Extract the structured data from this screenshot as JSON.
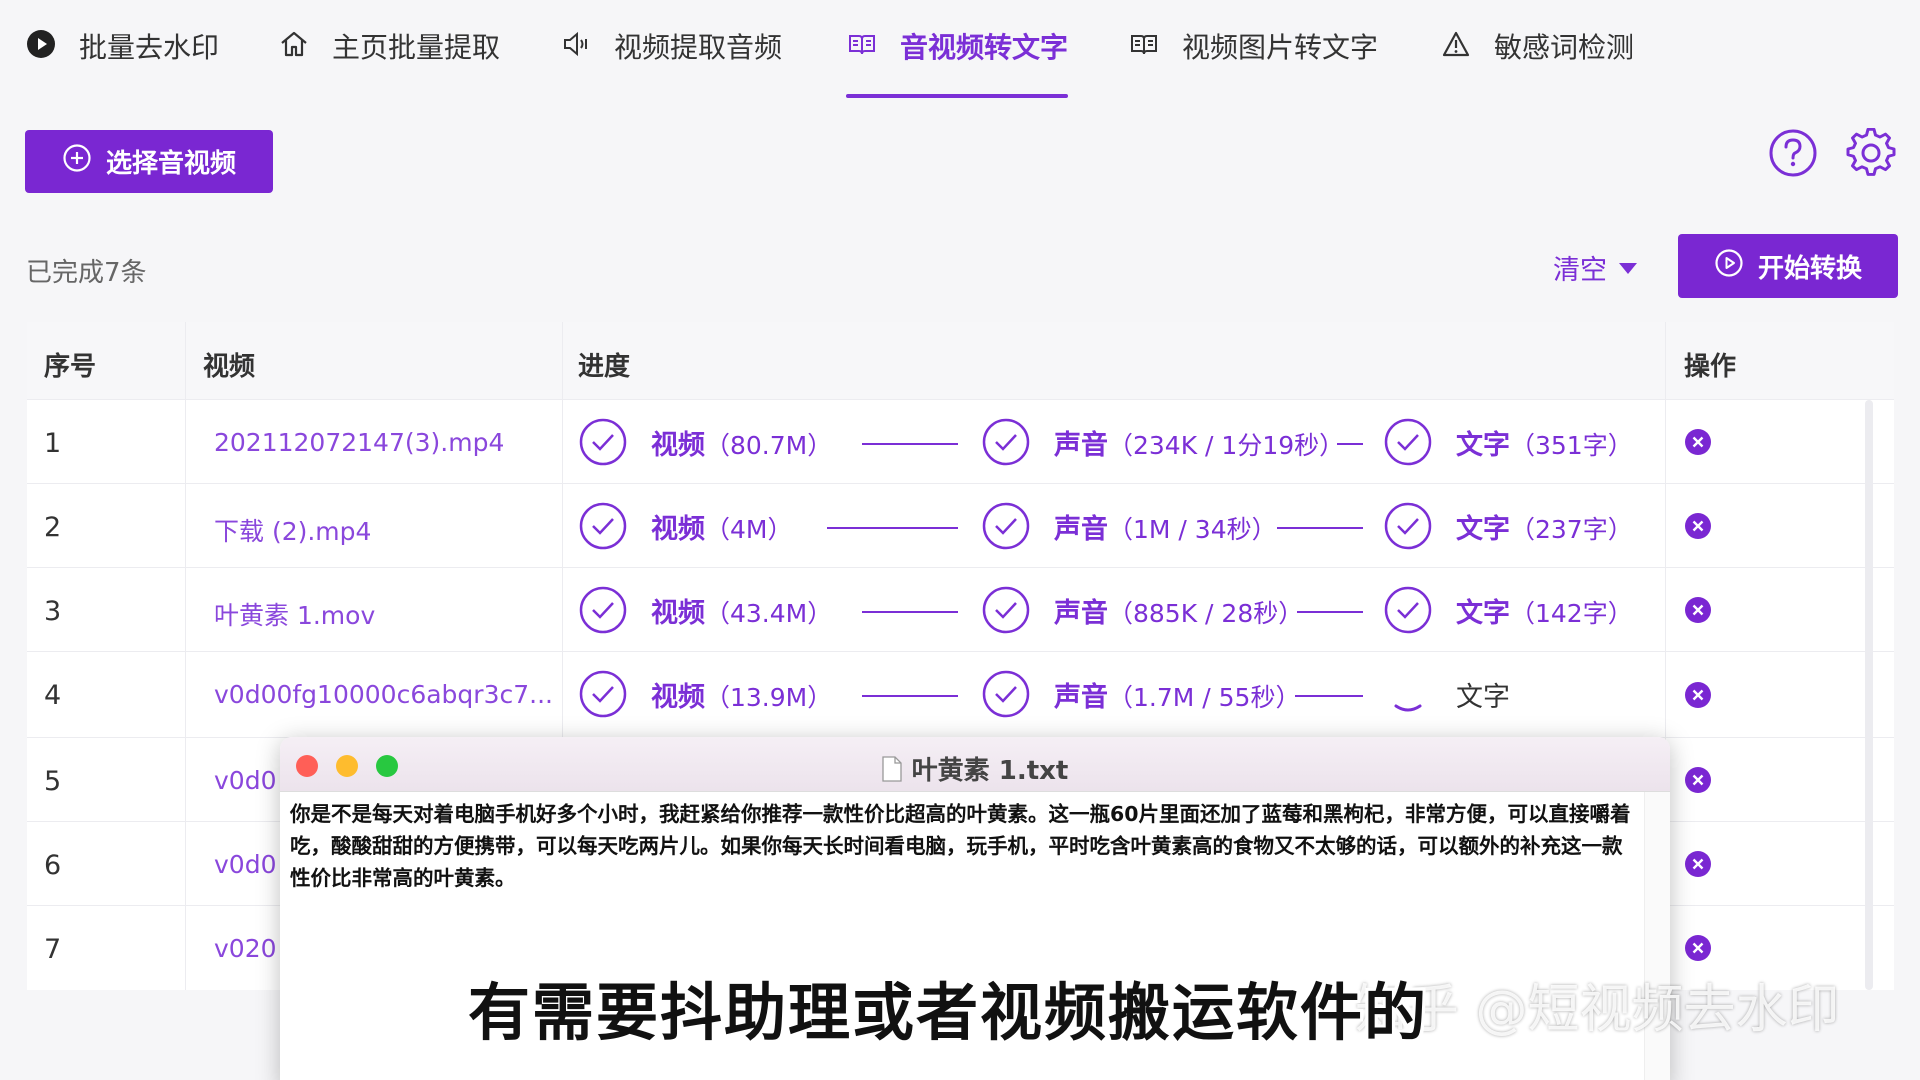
{
  "nav": {
    "items": [
      {
        "label": "批量去水印",
        "icon": "play-circle-icon"
      },
      {
        "label": "主页批量提取",
        "icon": "home-icon"
      },
      {
        "label": "视频提取音频",
        "icon": "speaker-icon"
      },
      {
        "label": "音视频转文字",
        "icon": "book-icon",
        "active": true
      },
      {
        "label": "视频图片转文字",
        "icon": "book-icon"
      },
      {
        "label": "敏感词检测",
        "icon": "warning-icon"
      }
    ]
  },
  "toolbar": {
    "select_label": "选择音视频",
    "done_text": "已完成7条",
    "clear_label": "清空",
    "start_label": "开始转换"
  },
  "table": {
    "headers": [
      "序号",
      "视频",
      "进度",
      "操作"
    ],
    "rows": [
      {
        "num": "1",
        "video": "202112072147(3).mp4",
        "video_stage": "视频",
        "video_info": "（80.7M）",
        "audio_stage": "声音",
        "audio_info": "（234K / 1分19秒）",
        "text_stage": "文字",
        "text_info": "（351字）"
      },
      {
        "num": "2",
        "video": "下载 (2).mp4",
        "video_stage": "视频",
        "video_info": "（4M）",
        "audio_stage": "声音",
        "audio_info": "（1M / 34秒）",
        "text_stage": "文字",
        "text_info": "（237字）"
      },
      {
        "num": "3",
        "video": "叶黄素 1.mov",
        "video_stage": "视频",
        "video_info": "（43.4M）",
        "audio_stage": "声音",
        "audio_info": "（885K / 28秒）",
        "text_stage": "文字",
        "text_info": "（142字）"
      },
      {
        "num": "4",
        "video": "v0d00fg10000c6abqr3c7...",
        "video_stage": "视频",
        "video_info": "（13.9M）",
        "audio_stage": "声音",
        "audio_info": "（1.7M / 55秒）",
        "text_stage": "文字",
        "text_info": ""
      },
      {
        "num": "5",
        "video": "v0d0"
      },
      {
        "num": "6",
        "video": "v0d0"
      },
      {
        "num": "7",
        "video": "v020"
      }
    ]
  },
  "window": {
    "title": "叶黄素 1.txt",
    "content": "你是不是每天对着电脑手机好多个小时，我赶紧给你推荐一款性价比超高的叶黄素。这一瓶60片里面还加了蓝莓和黑枸杞，非常方便，可以直接嚼着吃，酸酸甜甜的方便携带，可以每天吃两片儿。如果你每天长时间看电脑，玩手机，平时吃含叶黄素高的食物又不太够的话，可以额外的补充这一款性价比非常高的叶黄素。"
  },
  "subtitle": "有需要抖助理或者视频搬运软件的",
  "watermark": "知乎 @短视频去水印",
  "colors": {
    "accent": "#7a27d2",
    "link": "#8a47dc"
  }
}
